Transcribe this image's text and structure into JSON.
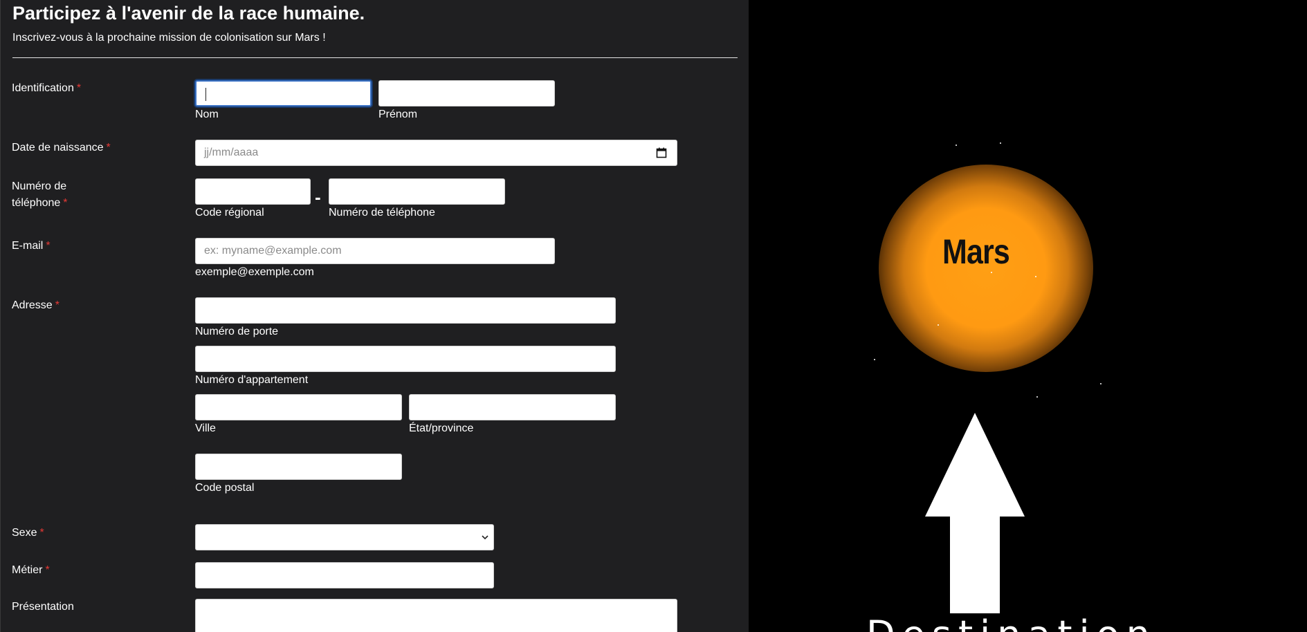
{
  "header": {
    "title": "Participez à l'avenir de la race humaine.",
    "subtitle": "Inscrivez-vous à la prochaine mission de colonisation sur Mars !"
  },
  "form": {
    "required_marker": "*",
    "identification": {
      "label": "Identification",
      "nom_value": "",
      "nom_sublabel": "Nom",
      "prenom_value": "",
      "prenom_sublabel": "Prénom"
    },
    "birthdate": {
      "label": "Date de naissance",
      "placeholder": "jj/mm/aaaa"
    },
    "phone": {
      "label_line1": "Numéro de",
      "label_line2": "téléphone",
      "dash": "-",
      "area_sublabel": "Code régional",
      "number_sublabel": "Numéro de téléphone"
    },
    "email": {
      "label": "E-mail",
      "placeholder": "ex: myname@example.com",
      "sublabel": "exemple@exemple.com"
    },
    "address": {
      "label": "Adresse",
      "door_sublabel": "Numéro de porte",
      "apartment_sublabel": "Numéro d'appartement",
      "city_sublabel": "Ville",
      "state_sublabel": "État/province",
      "postal_sublabel": "Code postal"
    },
    "sex": {
      "label": "Sexe",
      "selected": ""
    },
    "job": {
      "label": "Métier"
    },
    "presentation": {
      "label": "Présentation"
    }
  },
  "visual": {
    "planet_label": "Mars",
    "destination_text": "Destination"
  },
  "colors": {
    "panel_bg": "#1f1f21",
    "required": "#e53935",
    "planet": "#ff9f14",
    "focus": "#3a72c6"
  }
}
